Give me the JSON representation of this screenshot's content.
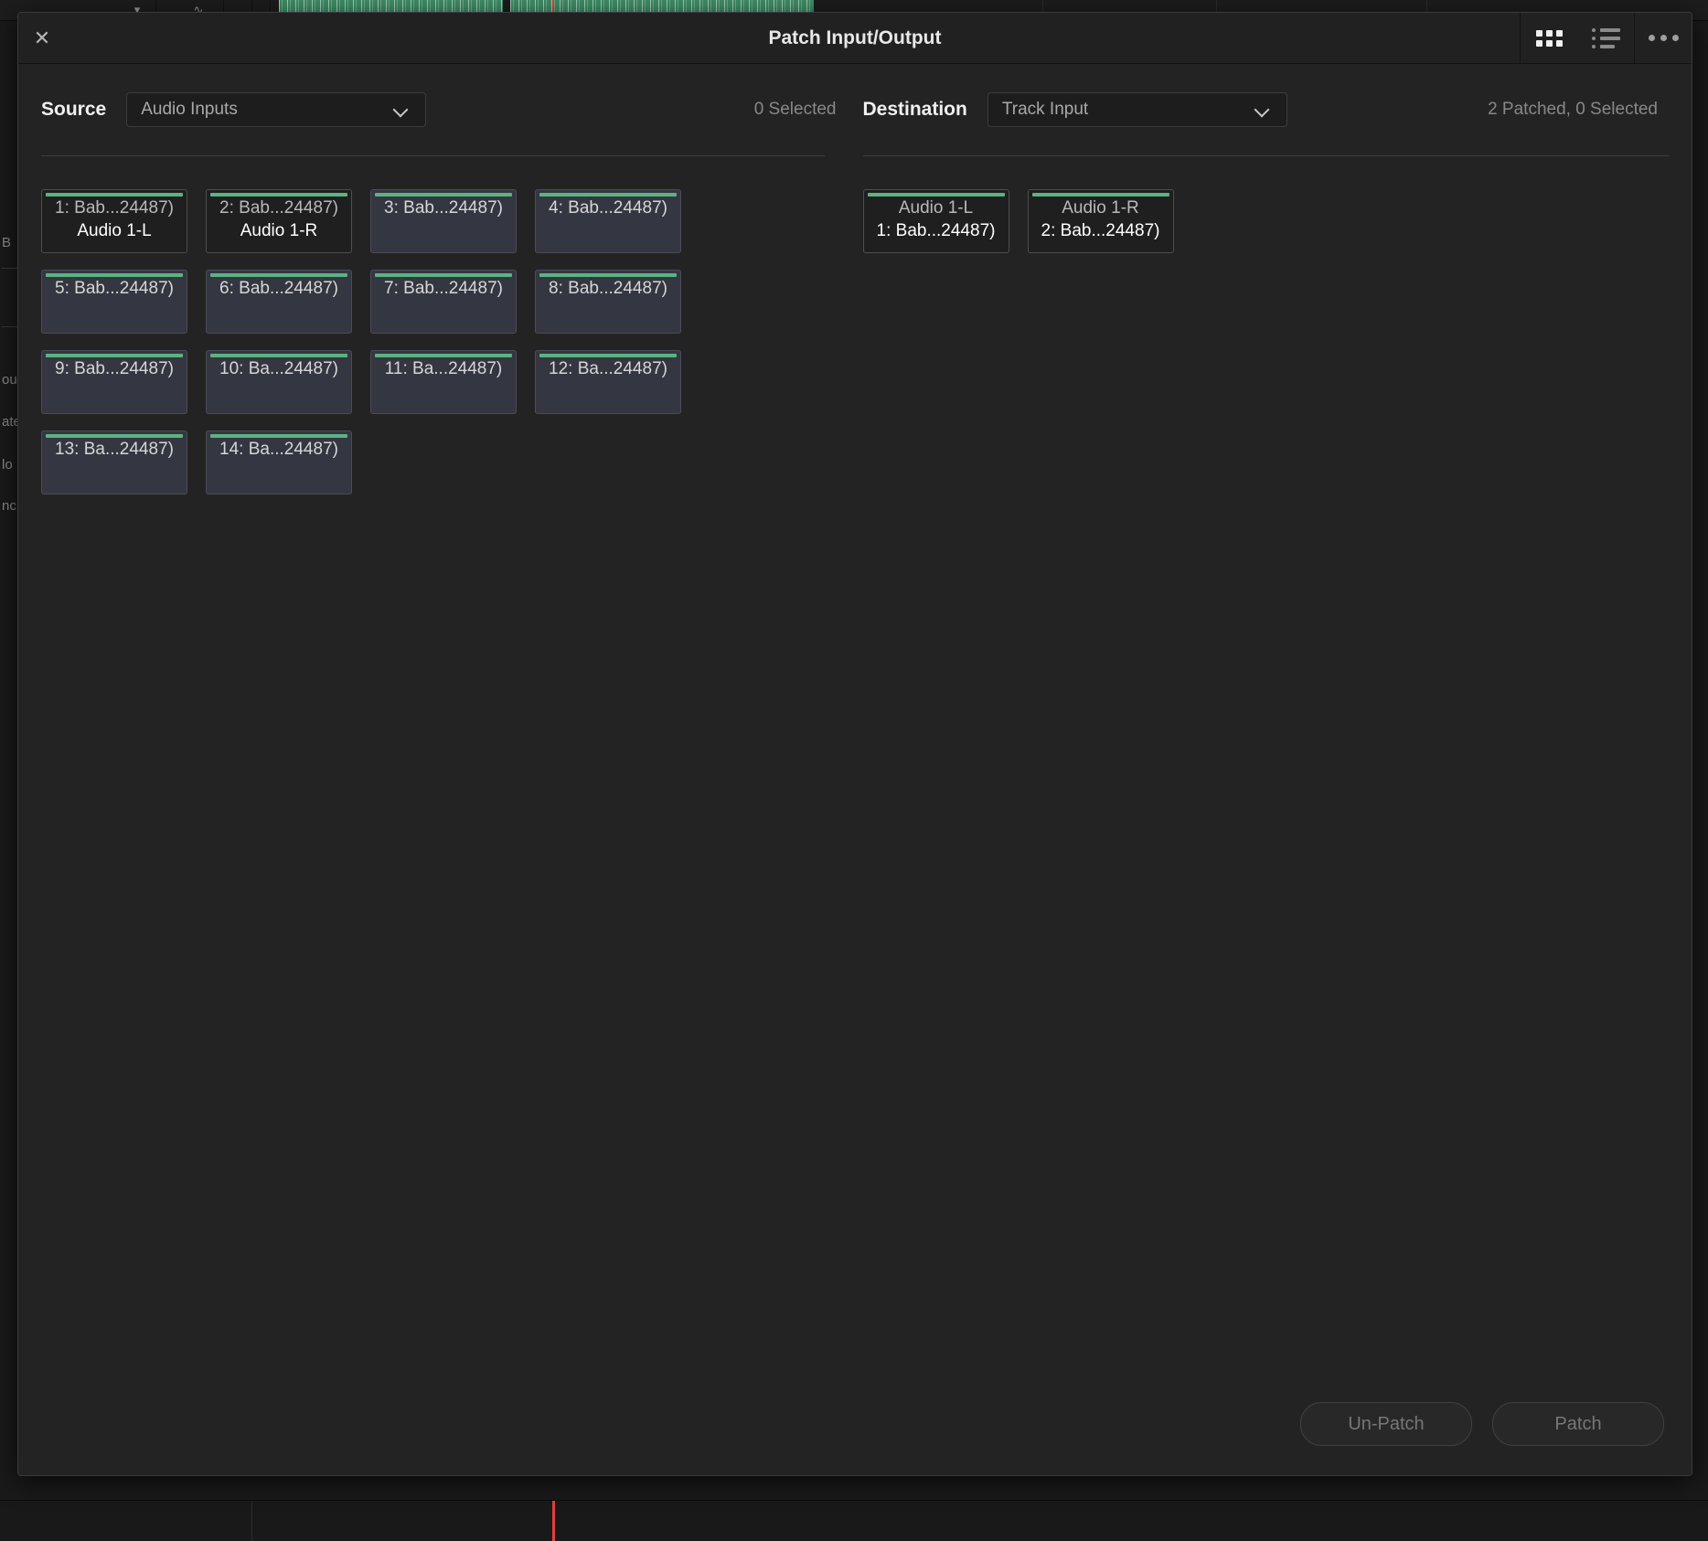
{
  "background": {
    "left_panel_labels": [
      "B",
      "ou",
      "ate",
      "lo",
      "nc"
    ]
  },
  "dialog": {
    "title": "Patch Input/Output",
    "close_icon": "close-icon",
    "view_grid_icon": "grid-view-icon",
    "view_list_icon": "list-view-icon",
    "options_icon": "ellipsis-icon"
  },
  "source": {
    "label": "Source",
    "dropdown_value": "Audio Inputs",
    "status": "0 Selected",
    "tiles": [
      {
        "line1": "1: Bab...24487)",
        "line2": "Audio 1-L",
        "patched": true
      },
      {
        "line1": "2: Bab...24487)",
        "line2": "Audio 1-R",
        "patched": true
      },
      {
        "line1": "3: Bab...24487)",
        "line2": "",
        "patched": false
      },
      {
        "line1": "4: Bab...24487)",
        "line2": "",
        "patched": false
      },
      {
        "line1": "5: Bab...24487)",
        "line2": "",
        "patched": false
      },
      {
        "line1": "6: Bab...24487)",
        "line2": "",
        "patched": false
      },
      {
        "line1": "7: Bab...24487)",
        "line2": "",
        "patched": false
      },
      {
        "line1": "8: Bab...24487)",
        "line2": "",
        "patched": false
      },
      {
        "line1": "9: Bab...24487)",
        "line2": "",
        "patched": false
      },
      {
        "line1": "10: Ba...24487)",
        "line2": "",
        "patched": false
      },
      {
        "line1": "11: Ba...24487)",
        "line2": "",
        "patched": false
      },
      {
        "line1": "12: Ba...24487)",
        "line2": "",
        "patched": false
      },
      {
        "line1": "13: Ba...24487)",
        "line2": "",
        "patched": false
      },
      {
        "line1": "14: Ba...24487)",
        "line2": "",
        "patched": false
      }
    ]
  },
  "destination": {
    "label": "Destination",
    "dropdown_value": "Track Input",
    "status": "2 Patched, 0 Selected",
    "tiles": [
      {
        "line1": "Audio 1-L",
        "line2": "1: Bab...24487)",
        "patched": true
      },
      {
        "line1": "Audio 1-R",
        "line2": "2: Bab...24487)",
        "patched": true
      }
    ]
  },
  "footer": {
    "unpatch_label": "Un-Patch",
    "patch_label": "Patch"
  },
  "colors": {
    "accent_green": "#5bb381",
    "dialog_bg": "#232323",
    "titlebar_bg": "#212121",
    "tile_bg": "#343741",
    "tile_patched_bg": "#1f1f1f"
  }
}
